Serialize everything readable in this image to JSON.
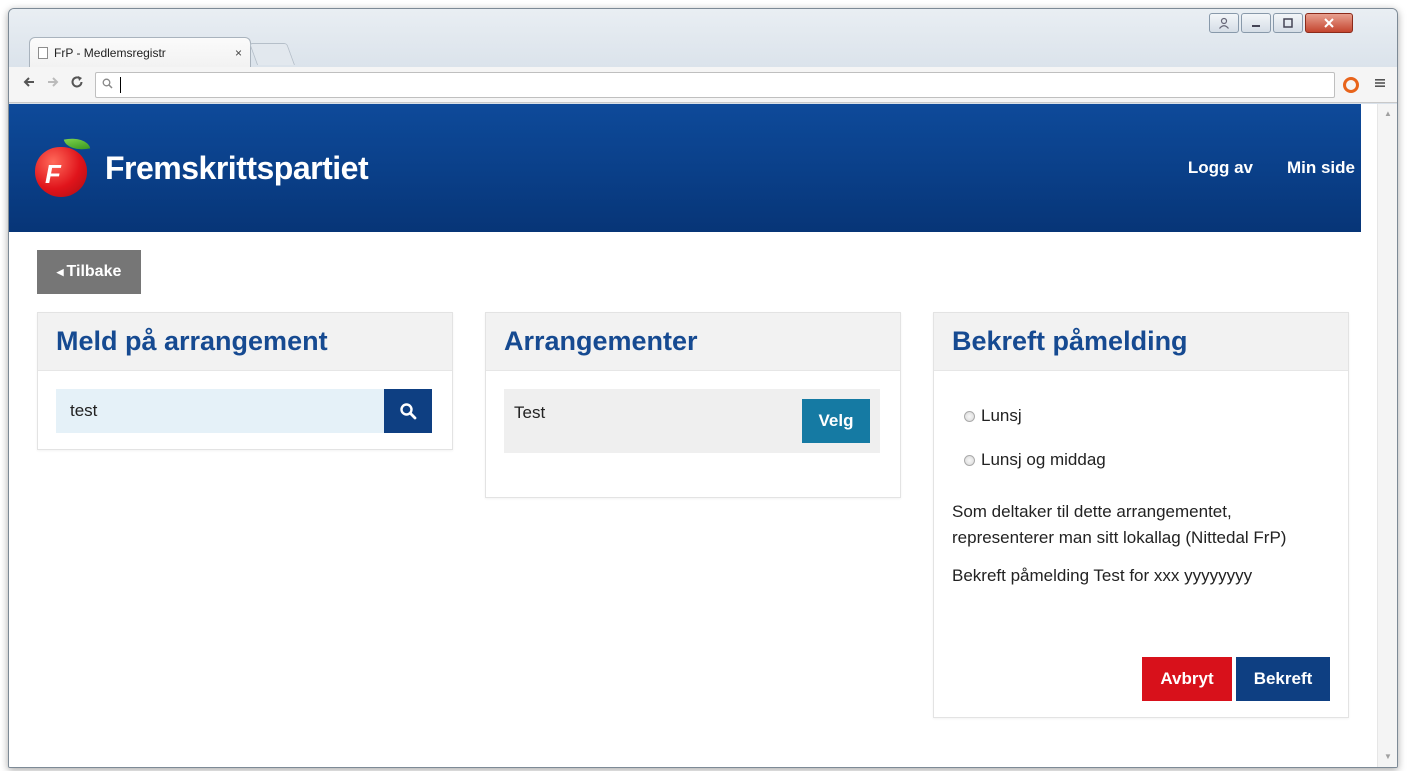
{
  "browser": {
    "tab_title": "FrP - Medlemsregistr",
    "tab_close": "×",
    "address": "",
    "icons": [
      "back-arrow-icon",
      "forward-arrow-icon",
      "reload-icon",
      "search-icon",
      "extension-icon",
      "menu-icon"
    ]
  },
  "header": {
    "brand": "Fremskrittspartiet",
    "nav": {
      "logout": "Logg av",
      "my_page": "Min side"
    },
    "colors": {
      "bar": "#0a3f88",
      "logo_red": "#e0141b",
      "leaf_green": "#4caf2a"
    }
  },
  "back_button": {
    "label": "Tilbake"
  },
  "register_panel": {
    "title": "Meld på arrangement",
    "search_value": "test"
  },
  "events_panel": {
    "title": "Arrangementer",
    "items": [
      {
        "name": "Test",
        "action": "Velg"
      }
    ]
  },
  "confirm_panel": {
    "title": "Bekreft påmelding",
    "options": [
      {
        "label": "Lunsj"
      },
      {
        "label": "Lunsj og middag"
      }
    ],
    "info": "Som deltaker til dette arrangementet, representerer man sitt lokallag (Nittedal FrP)",
    "summary": "Bekreft påmelding Test for xxx yyyyyyyy",
    "cancel_label": "Avbryt",
    "confirm_label": "Bekreft",
    "colors": {
      "cancel": "#d8111b",
      "confirm": "#0e3f82",
      "title": "#164a91"
    }
  }
}
